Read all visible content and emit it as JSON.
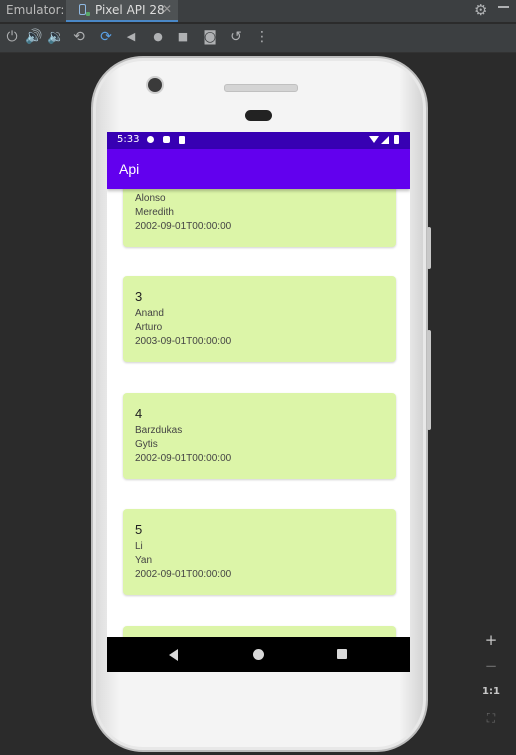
{
  "ide": {
    "emulator_label": "Emulator:",
    "tab_title": "Pixel API 28",
    "tab_close": "✕",
    "settings_icon": "gear-icon",
    "minimize_icon": "minus-icon",
    "toolbar_icons": [
      "power-icon",
      "volume-up-icon",
      "volume-down-icon",
      "rotate-left-icon",
      "rotate-right-icon",
      "back-icon",
      "home-icon",
      "overview-icon",
      "screenshot-icon",
      "snapshot-icon",
      "more-icon"
    ]
  },
  "device": {
    "status": {
      "time": "5:33"
    },
    "app_title": "Api",
    "items": [
      {
        "id": "",
        "last_name": "Alonso",
        "first_name": "Meredith",
        "date": "2002-09-01T00:00:00"
      },
      {
        "id": "3",
        "last_name": "Anand",
        "first_name": "Arturo",
        "date": "2003-09-01T00:00:00"
      },
      {
        "id": "4",
        "last_name": "Barzdukas",
        "first_name": "Gytis",
        "date": "2002-09-01T00:00:00"
      },
      {
        "id": "5",
        "last_name": "Li",
        "first_name": "Yan",
        "date": "2002-09-01T00:00:00"
      }
    ]
  },
  "zoom": {
    "zoom_in": "+",
    "zoom_out": "−",
    "actual_size": "1:1"
  }
}
